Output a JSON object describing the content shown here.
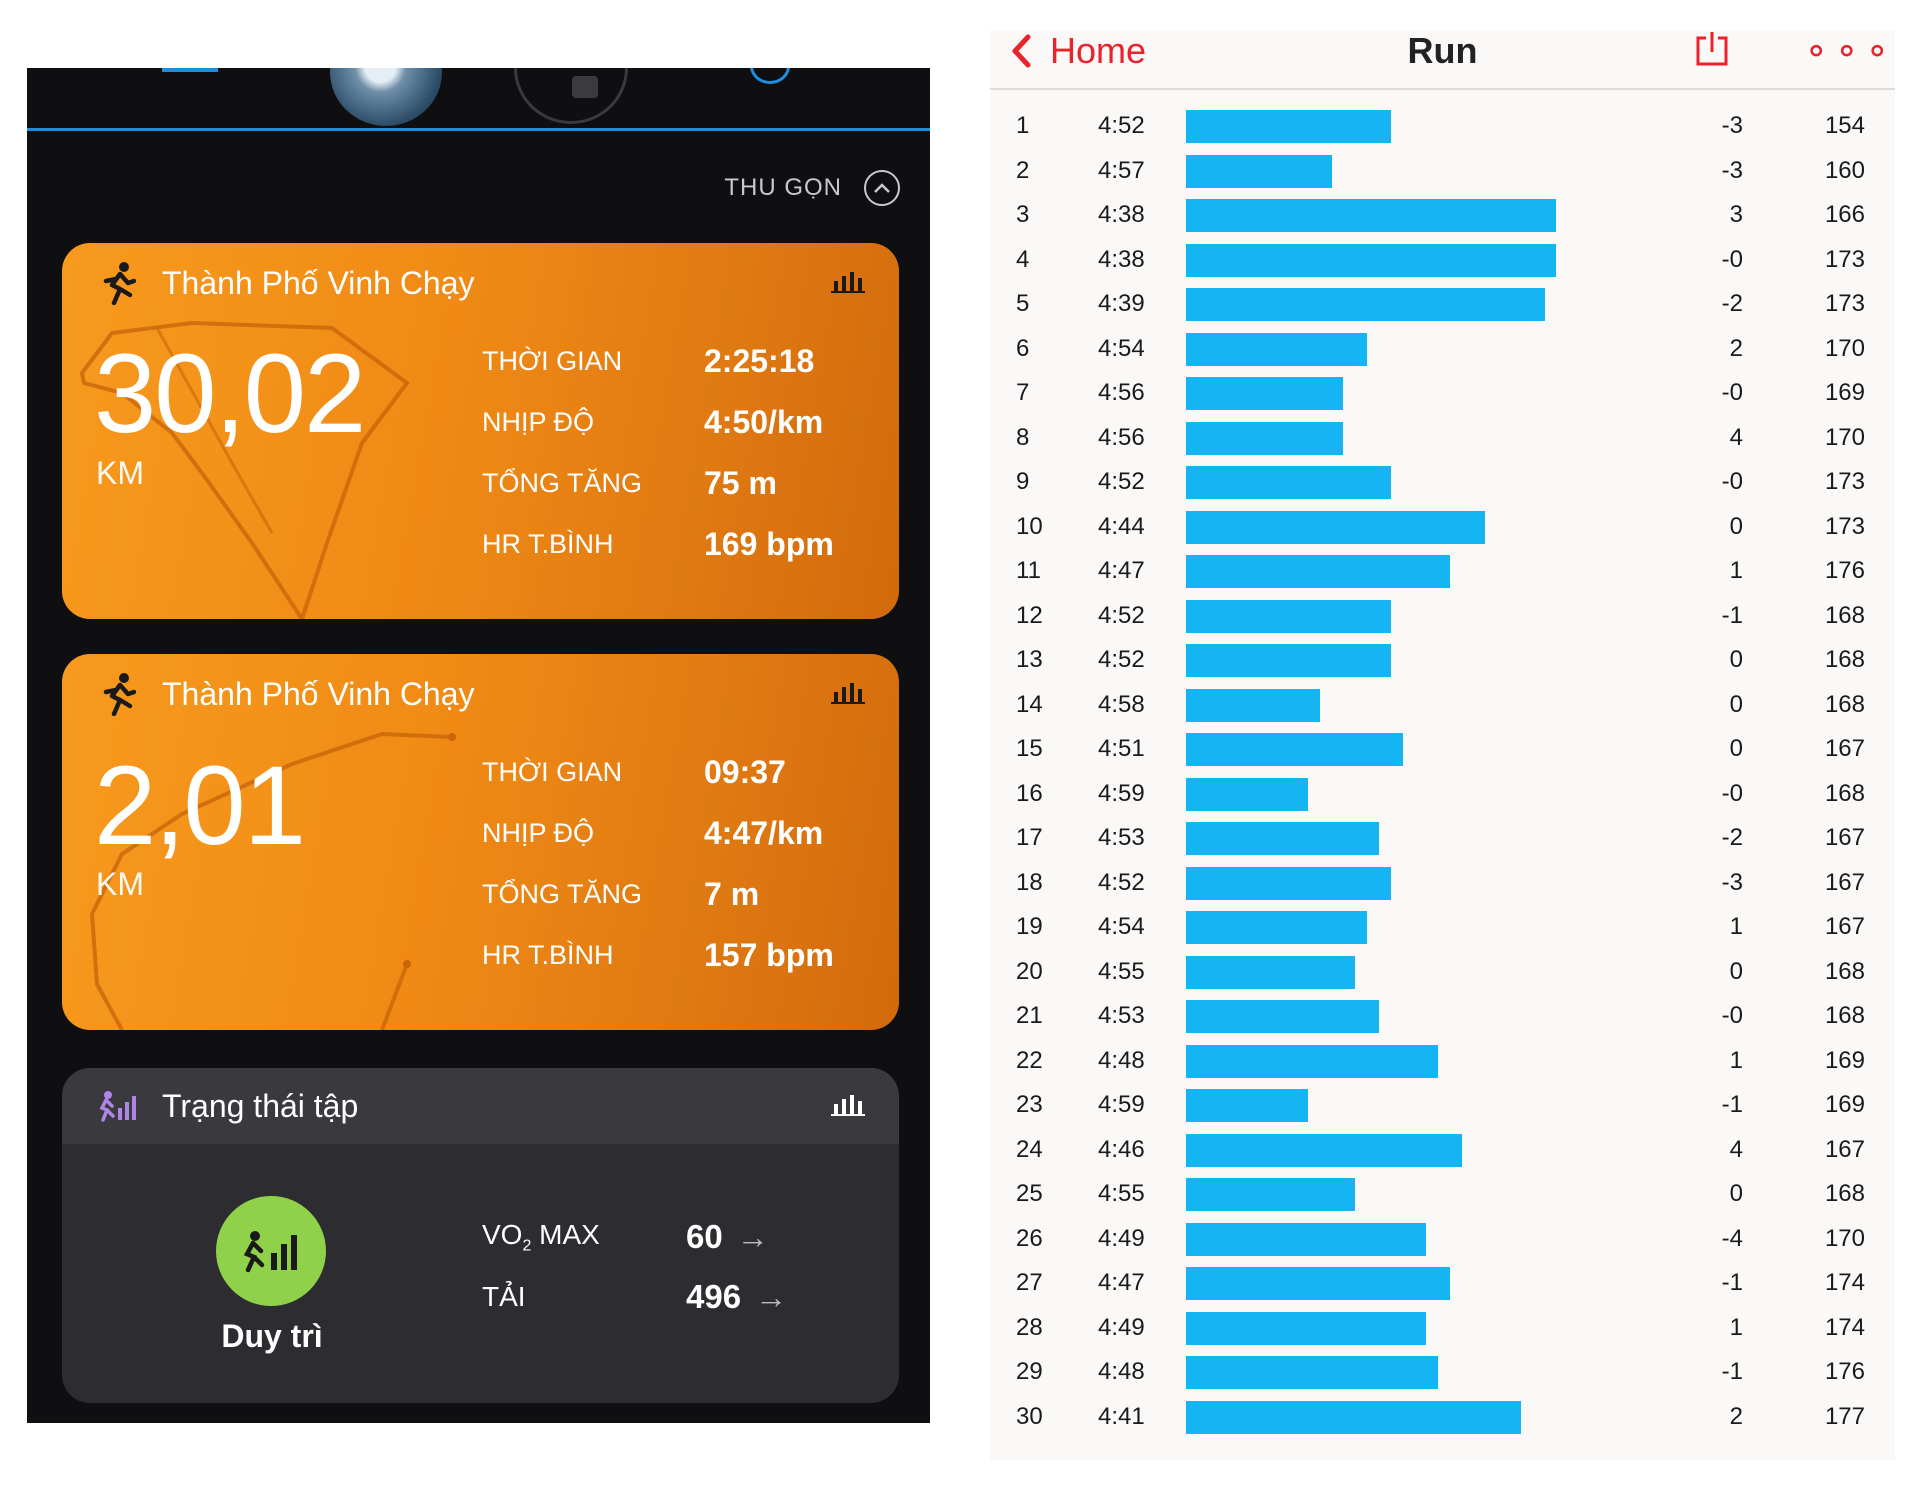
{
  "left_app": {
    "collapse_label": "THU GỌN",
    "activities": [
      {
        "title": "Thành Phố Vinh Chạy",
        "distance": "30,02",
        "unit": "KM",
        "stats": [
          {
            "label": "THỜI GIAN",
            "value": "2:25:18"
          },
          {
            "label": "NHỊP ĐỘ",
            "value": "4:50/km"
          },
          {
            "label": "TỔNG TĂNG",
            "value": "75 m"
          },
          {
            "label": "HR T.BÌNH",
            "value": "169 bpm"
          }
        ]
      },
      {
        "title": "Thành Phố Vinh Chạy",
        "distance": "2,01",
        "unit": "KM",
        "stats": [
          {
            "label": "THỜI GIAN",
            "value": "09:37"
          },
          {
            "label": "NHỊP ĐỘ",
            "value": "4:47/km"
          },
          {
            "label": "TỔNG TĂNG",
            "value": "7 m"
          },
          {
            "label": "HR T.BÌNH",
            "value": "157 bpm"
          }
        ]
      }
    ],
    "training_status": {
      "title": "Trạng thái tập",
      "badge_label": "Duy trì",
      "vo2_label_main": "VO",
      "vo2_label_sub": "2",
      "vo2_label_tail": " MAX",
      "vo2_value": "60",
      "load_label": "TẢI",
      "load_value": "496"
    },
    "colors": {
      "card_orange": "#f08a15",
      "accent_blue": "#1d8fe0",
      "status_green": "#8fd24a"
    }
  },
  "run_screen": {
    "back_label": "Home",
    "title": "Run",
    "bar_color": "#14b5f2",
    "nav_color": "#e8232b",
    "bar_scale": {
      "min_pace_seconds": 240,
      "max_pace_seconds": 300
    },
    "splits": [
      {
        "km": "1",
        "pace": "4:52",
        "elev": "-3",
        "hr": "154"
      },
      {
        "km": "2",
        "pace": "4:57",
        "elev": "-3",
        "hr": "160"
      },
      {
        "km": "3",
        "pace": "4:38",
        "elev": "3",
        "hr": "166"
      },
      {
        "km": "4",
        "pace": "4:38",
        "elev": "-0",
        "hr": "173"
      },
      {
        "km": "5",
        "pace": "4:39",
        "elev": "-2",
        "hr": "173"
      },
      {
        "km": "6",
        "pace": "4:54",
        "elev": "2",
        "hr": "170"
      },
      {
        "km": "7",
        "pace": "4:56",
        "elev": "-0",
        "hr": "169"
      },
      {
        "km": "8",
        "pace": "4:56",
        "elev": "4",
        "hr": "170"
      },
      {
        "km": "9",
        "pace": "4:52",
        "elev": "-0",
        "hr": "173"
      },
      {
        "km": "10",
        "pace": "4:44",
        "elev": "0",
        "hr": "173"
      },
      {
        "km": "11",
        "pace": "4:47",
        "elev": "1",
        "hr": "176"
      },
      {
        "km": "12",
        "pace": "4:52",
        "elev": "-1",
        "hr": "168"
      },
      {
        "km": "13",
        "pace": "4:52",
        "elev": "0",
        "hr": "168"
      },
      {
        "km": "14",
        "pace": "4:58",
        "elev": "0",
        "hr": "168"
      },
      {
        "km": "15",
        "pace": "4:51",
        "elev": "0",
        "hr": "167"
      },
      {
        "km": "16",
        "pace": "4:59",
        "elev": "-0",
        "hr": "168"
      },
      {
        "km": "17",
        "pace": "4:53",
        "elev": "-2",
        "hr": "167"
      },
      {
        "km": "18",
        "pace": "4:52",
        "elev": "-3",
        "hr": "167"
      },
      {
        "km": "19",
        "pace": "4:54",
        "elev": "1",
        "hr": "167"
      },
      {
        "km": "20",
        "pace": "4:55",
        "elev": "0",
        "hr": "168"
      },
      {
        "km": "21",
        "pace": "4:53",
        "elev": "-0",
        "hr": "168"
      },
      {
        "km": "22",
        "pace": "4:48",
        "elev": "1",
        "hr": "169"
      },
      {
        "km": "23",
        "pace": "4:59",
        "elev": "-1",
        "hr": "169"
      },
      {
        "km": "24",
        "pace": "4:46",
        "elev": "4",
        "hr": "167"
      },
      {
        "km": "25",
        "pace": "4:55",
        "elev": "0",
        "hr": "168"
      },
      {
        "km": "26",
        "pace": "4:49",
        "elev": "-4",
        "hr": "170"
      },
      {
        "km": "27",
        "pace": "4:47",
        "elev": "-1",
        "hr": "174"
      },
      {
        "km": "28",
        "pace": "4:49",
        "elev": "1",
        "hr": "174"
      },
      {
        "km": "29",
        "pace": "4:48",
        "elev": "-1",
        "hr": "176"
      },
      {
        "km": "30",
        "pace": "4:41",
        "elev": "2",
        "hr": "177"
      }
    ]
  }
}
